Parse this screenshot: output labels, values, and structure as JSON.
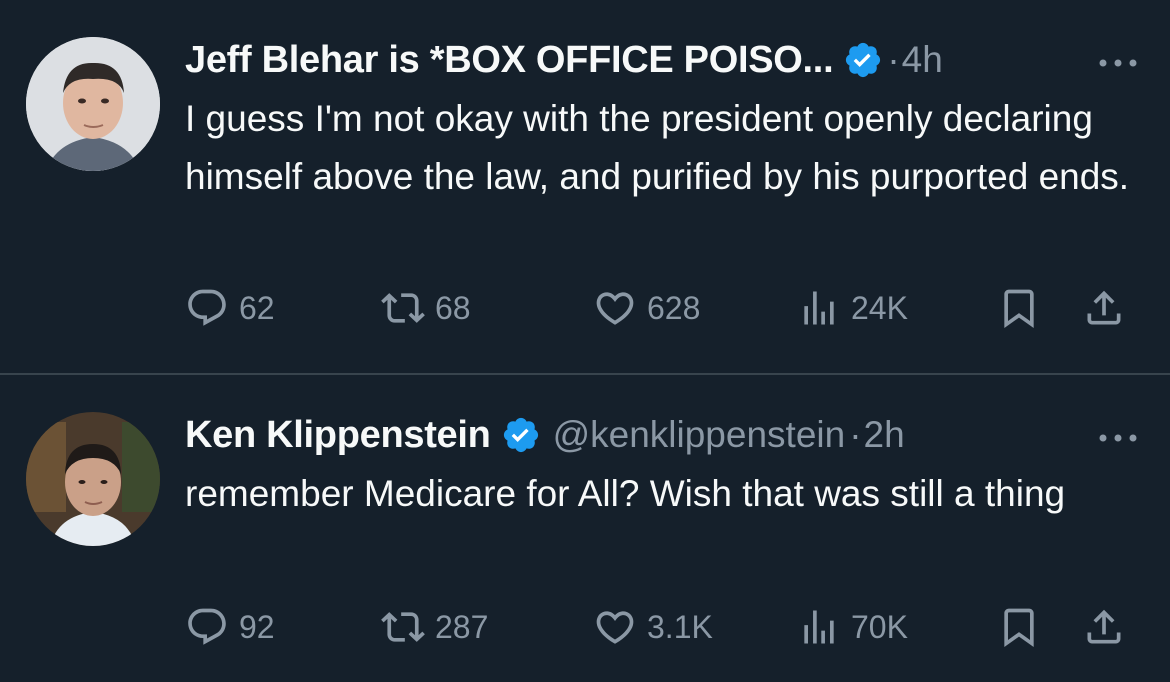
{
  "tweets": [
    {
      "name": "Jeff Blehar is *BOX OFFICE POISO...",
      "handle": "",
      "time": "4h",
      "text": "I guess I'm not okay with the president openly declaring himself above the law, and purified by his purported ends.",
      "replies": "62",
      "retweets": "68",
      "likes": "628",
      "views": "24K"
    },
    {
      "name": "Ken Klippenstein",
      "handle": "@kenklippenstein",
      "time": "2h",
      "text": "remember Medicare for All? Wish that was still a thing",
      "replies": "92",
      "retweets": "287",
      "likes": "3.1K",
      "views": "70K"
    }
  ],
  "separator": "·",
  "icons": {
    "verified": "verified-badge-icon",
    "more": "more-icon",
    "reply": "reply-icon",
    "retweet": "retweet-icon",
    "like": "heart-icon",
    "views": "views-icon",
    "bookmark": "bookmark-icon",
    "share": "share-icon"
  },
  "colors": {
    "background": "#15202b",
    "text": "#f7f9f9",
    "secondary": "#8b98a5",
    "verified": "#1d9bf0",
    "divider": "#38444d"
  }
}
